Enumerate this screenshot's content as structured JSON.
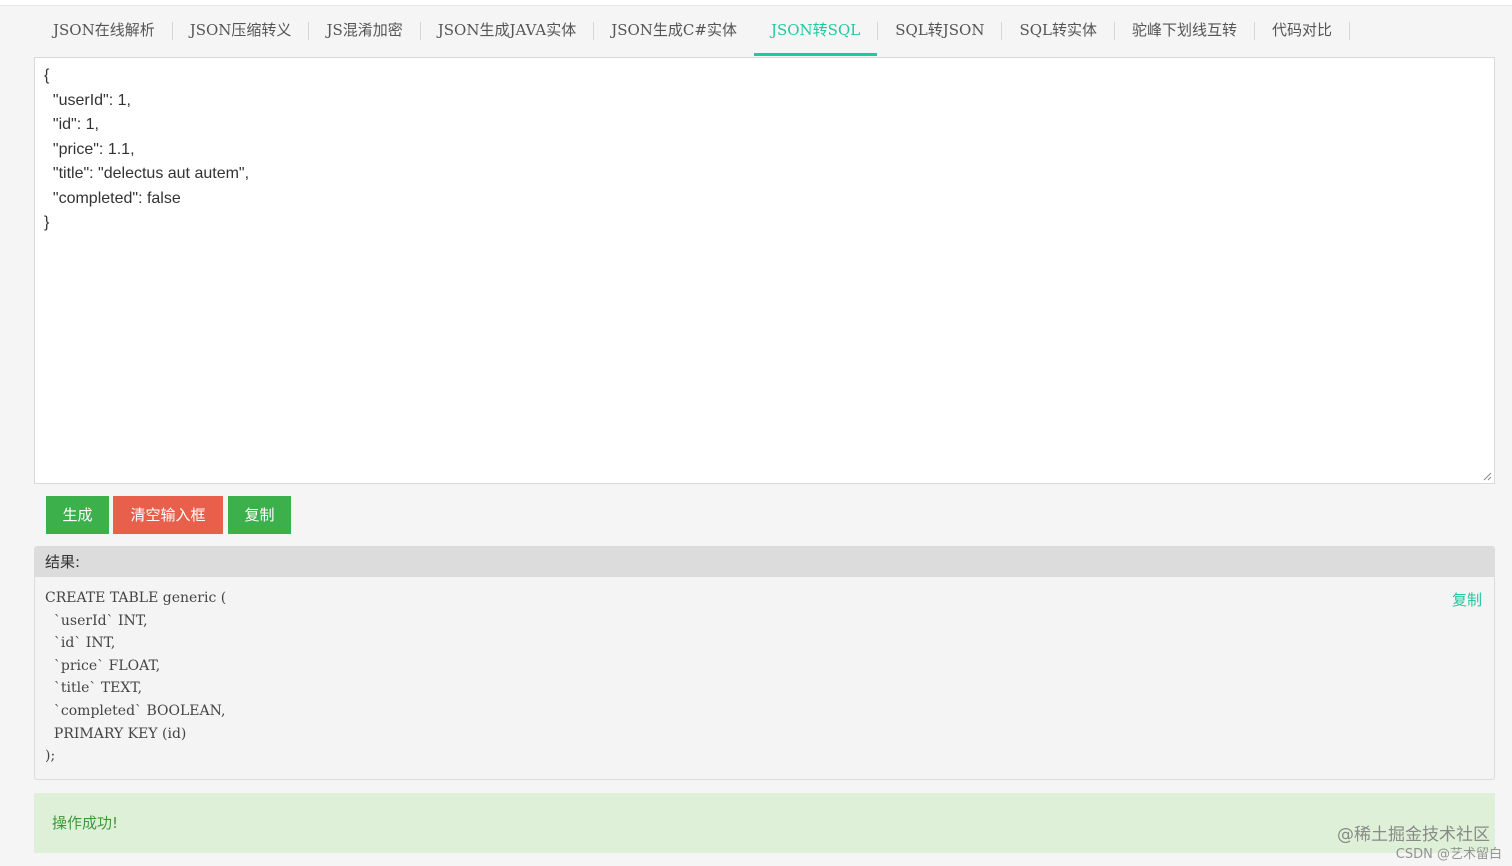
{
  "tabs": [
    {
      "label": "JSON在线解析"
    },
    {
      "label": "JSON压缩转义"
    },
    {
      "label": "JS混淆加密"
    },
    {
      "label": "JSON生成JAVA实体"
    },
    {
      "label": "JSON生成C#实体"
    },
    {
      "label": "JSON转SQL",
      "active": true
    },
    {
      "label": "SQL转JSON"
    },
    {
      "label": "SQL转实体"
    },
    {
      "label": "驼峰下划线互转"
    },
    {
      "label": "代码对比"
    }
  ],
  "editor": {
    "value": "{\n  \"userId\": 1,\n  \"id\": 1,\n  \"price\": 1.1,\n  \"title\": \"delectus aut autem\",\n  \"completed\": false\n}"
  },
  "buttons": {
    "generate": "生成",
    "clear": "清空输入框",
    "copy": "复制"
  },
  "result": {
    "header": "结果:",
    "copy_label": "复制",
    "code": "CREATE TABLE generic (\n  `userId` INT,\n  `id` INT,\n  `price` FLOAT,\n  `title` TEXT,\n  `completed` BOOLEAN,\n  PRIMARY KEY (id)\n);"
  },
  "status": {
    "message": "操作成功!"
  },
  "watermark": {
    "line1": "@稀土掘金技术社区",
    "line2": "CSDN @艺术留白"
  },
  "colors": {
    "accent": "#1fc9a0",
    "primary_button": "#3cb04a",
    "danger_button": "#e8604c",
    "success_bg": "#dff0d8",
    "success_text": "#3c9a3c"
  }
}
